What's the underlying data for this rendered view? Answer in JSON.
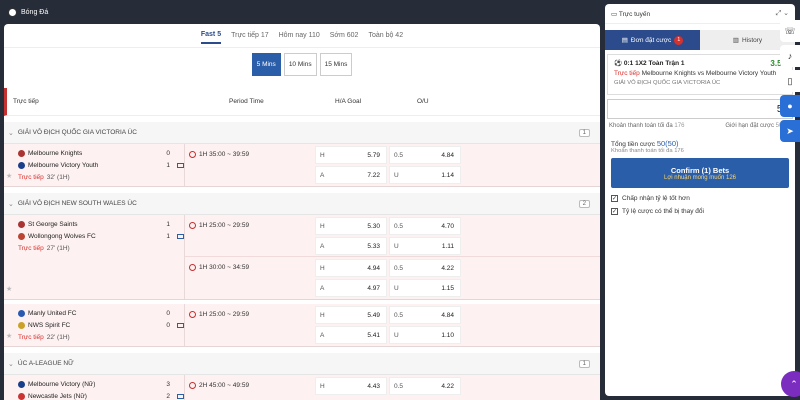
{
  "header": {
    "title": "Bóng Đá"
  },
  "tabs": [
    {
      "label": "Fast 5",
      "active": true
    },
    {
      "label": "Trực tiếp 17",
      "active": false
    },
    {
      "label": "Hôm nay 110",
      "active": false
    },
    {
      "label": "Sớm 602",
      "active": false
    },
    {
      "label": "Toàn bộ 42",
      "active": false
    }
  ],
  "periods": [
    {
      "label": "5 Mins",
      "active": true
    },
    {
      "label": "10 Mins",
      "active": false
    },
    {
      "label": "15 Mins",
      "active": false
    }
  ],
  "columns": {
    "live": "Trực tiếp",
    "period": "Period Time",
    "hagoal": "H/A Goal",
    "ou": "O/U"
  },
  "leagues": [
    {
      "name": "GIẢI VÔ ĐỊCH QUỐC GIA VICTORIA ÚC",
      "count": "1",
      "matches": [
        {
          "home": "Melbourne Knights",
          "home_score": "0",
          "away": "Melbourne Victory Youth",
          "away_score": "1",
          "live_label": "Trực tiếp",
          "time": "32' (1H)",
          "markets": [
            {
              "period": "1H 35:00 ~ 39:59",
              "h_label": "H",
              "h": "5.79",
              "a_label": "A",
              "a": "7.22",
              "line": "0.5",
              "o": "4.84",
              "u_label": "U",
              "u": "1.14"
            }
          ]
        }
      ]
    },
    {
      "name": "GIẢI VÔ ĐỊCH NEW SOUTH WALES ÚC",
      "count": "2",
      "matches": [
        {
          "home": "St George Saints",
          "home_score": "1",
          "away": "Wollongong Wolves FC",
          "away_score": "1",
          "live_label": "Trực tiếp",
          "time": "27' (1H)",
          "markets": [
            {
              "period": "1H 25:00 ~ 29:59",
              "h_label": "H",
              "h": "5.30",
              "a_label": "A",
              "a": "5.33",
              "line": "0.5",
              "o": "4.70",
              "u_label": "U",
              "u": "1.11"
            },
            {
              "period": "1H 30:00 ~ 34:59",
              "h_label": "H",
              "h": "4.94",
              "a_label": "A",
              "a": "4.97",
              "line": "0.5",
              "o": "4.22",
              "u_label": "U",
              "u": "1.15"
            }
          ]
        },
        {
          "home": "Manly United FC",
          "home_score": "0",
          "away": "NWS Spirit FC",
          "away_score": "0",
          "live_label": "Trực tiếp",
          "time": "22' (1H)",
          "markets": [
            {
              "period": "1H 25:00 ~ 29:59",
              "h_label": "H",
              "h": "5.49",
              "a_label": "A",
              "a": "5.41",
              "line": "0.5",
              "o": "4.84",
              "u_label": "U",
              "u": "1.10"
            }
          ]
        }
      ]
    },
    {
      "name": "ÚC A-LEAGUE NỮ",
      "count": "1",
      "matches": [
        {
          "home": "Melbourne Victory (Nữ)",
          "home_score": "3",
          "away": "Newcastle Jets (Nữ)",
          "away_score": "2",
          "markets": [
            {
              "period": "2H 45:00 ~ 49:59",
              "h_label": "H",
              "h": "4.43",
              "line": "0.5",
              "o": "4.22"
            }
          ]
        }
      ]
    }
  ],
  "betslip": {
    "title": "Trực tuyến",
    "tab_bets": "Đơn đặt cược",
    "tab_bets_count": "1",
    "tab_history": "History",
    "selection": "0:1 1X2 Toàn Trận 1",
    "odds": "3.52",
    "live": "Trực tiếp",
    "match": "Melbourne Knights vs Melbourne Victory Youth",
    "league": "GIẢI VÔ ĐỊCH QUỐC GIA VICTORIA ÚC",
    "stake": "50",
    "min_label": "Khoản thanh toán tối đa",
    "min_value": "176",
    "max_label": "Giới hạn đặt cược",
    "max_value": "50-12",
    "total_label": "Tổng tiền cược",
    "total_value": "50(50)",
    "payout_label": "Khoản thanh toán tối đa",
    "payout_value": "176",
    "confirm": "Confirm (1) Bets",
    "profit_label": "Lợi nhuận mong muốn",
    "profit_value": "126",
    "opt1": "Chấp nhận tỷ lệ tốt hơn",
    "opt2": "Tỷ lệ cược có thể bị thay đổi"
  }
}
